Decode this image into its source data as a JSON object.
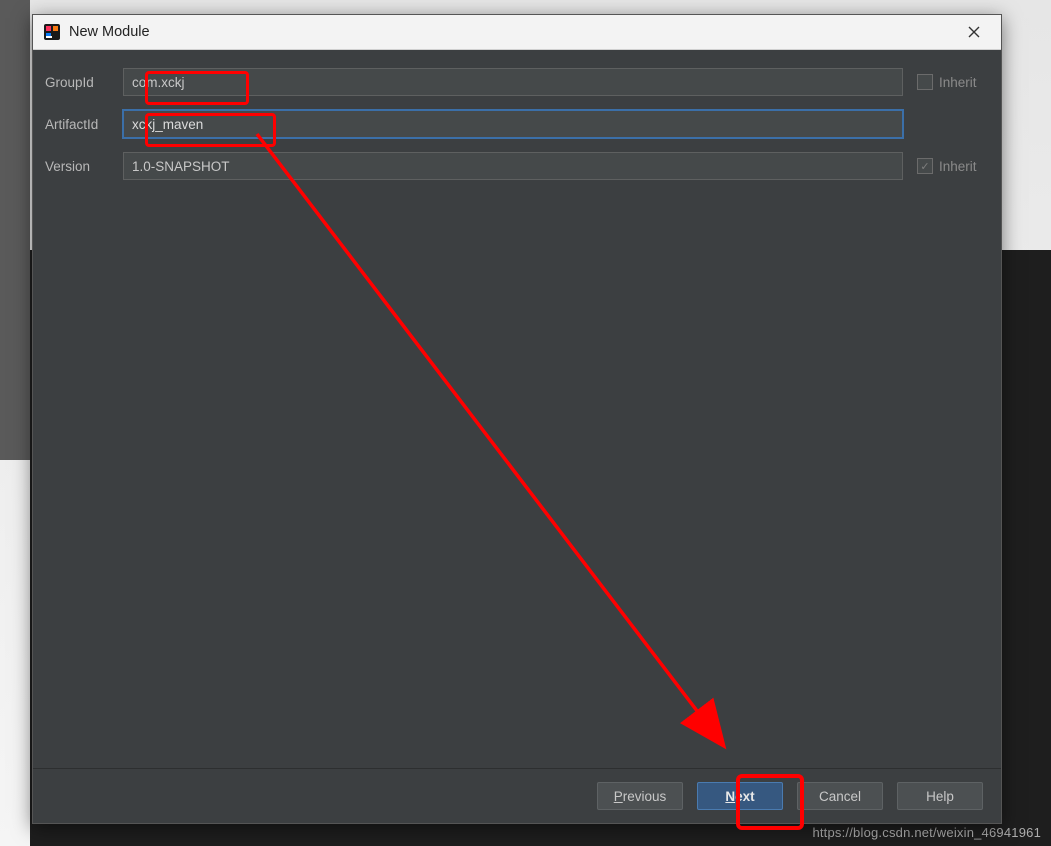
{
  "window": {
    "title": "New Module"
  },
  "form": {
    "groupId": {
      "label": "GroupId",
      "value": "com.xckj",
      "inherit_label": "Inherit",
      "inherit_checked": false
    },
    "artifactId": {
      "label": "ArtifactId",
      "value": "xckj_maven"
    },
    "version": {
      "label": "Version",
      "value": "1.0-SNAPSHOT",
      "inherit_label": "Inherit",
      "inherit_checked": true
    }
  },
  "buttons": {
    "previous": "Previous",
    "next": "Next",
    "cancel": "Cancel",
    "help": "Help"
  },
  "watermark": "https://blog.csdn.net/weixin_46941961"
}
